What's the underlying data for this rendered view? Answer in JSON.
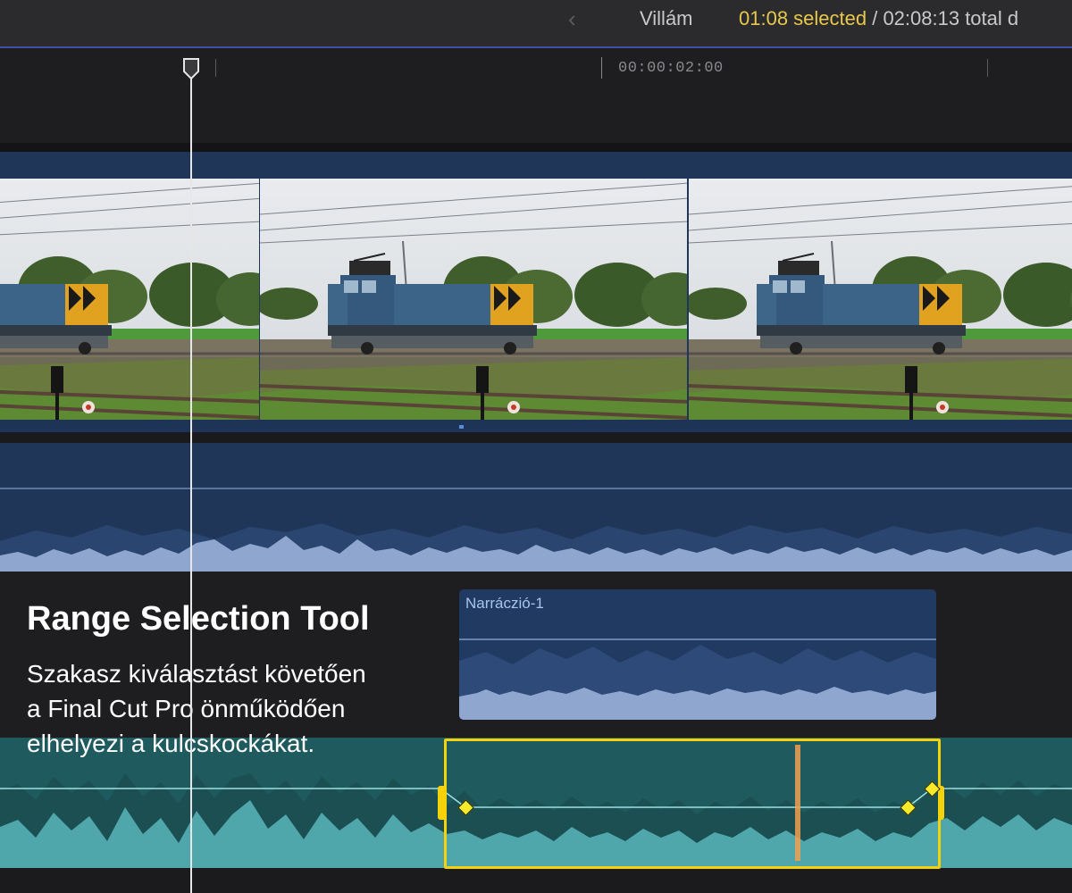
{
  "topbar": {
    "back_icon": "chevron-left-icon",
    "project_name": "Villám",
    "selected_duration": "01:08 selected",
    "total_duration": " / 02:08:13 total d"
  },
  "ruler": {
    "timecode_label": "00:00:02:00"
  },
  "narration_clip": {
    "name": "Narráczió-1"
  },
  "overlay": {
    "title": "Range Selection Tool",
    "description_lines": [
      "Szakasz kiválasztást követően",
      "a Final Cut Pro önműködően",
      "elhelyezi a kulcskockákat."
    ]
  },
  "colors": {
    "selection": "#f5d20a",
    "keyframe": "#f7ea2a",
    "clip_blue": "#1f3659",
    "music_teal": "#1e5a5e",
    "accent_yellow": "#e8c84a"
  }
}
